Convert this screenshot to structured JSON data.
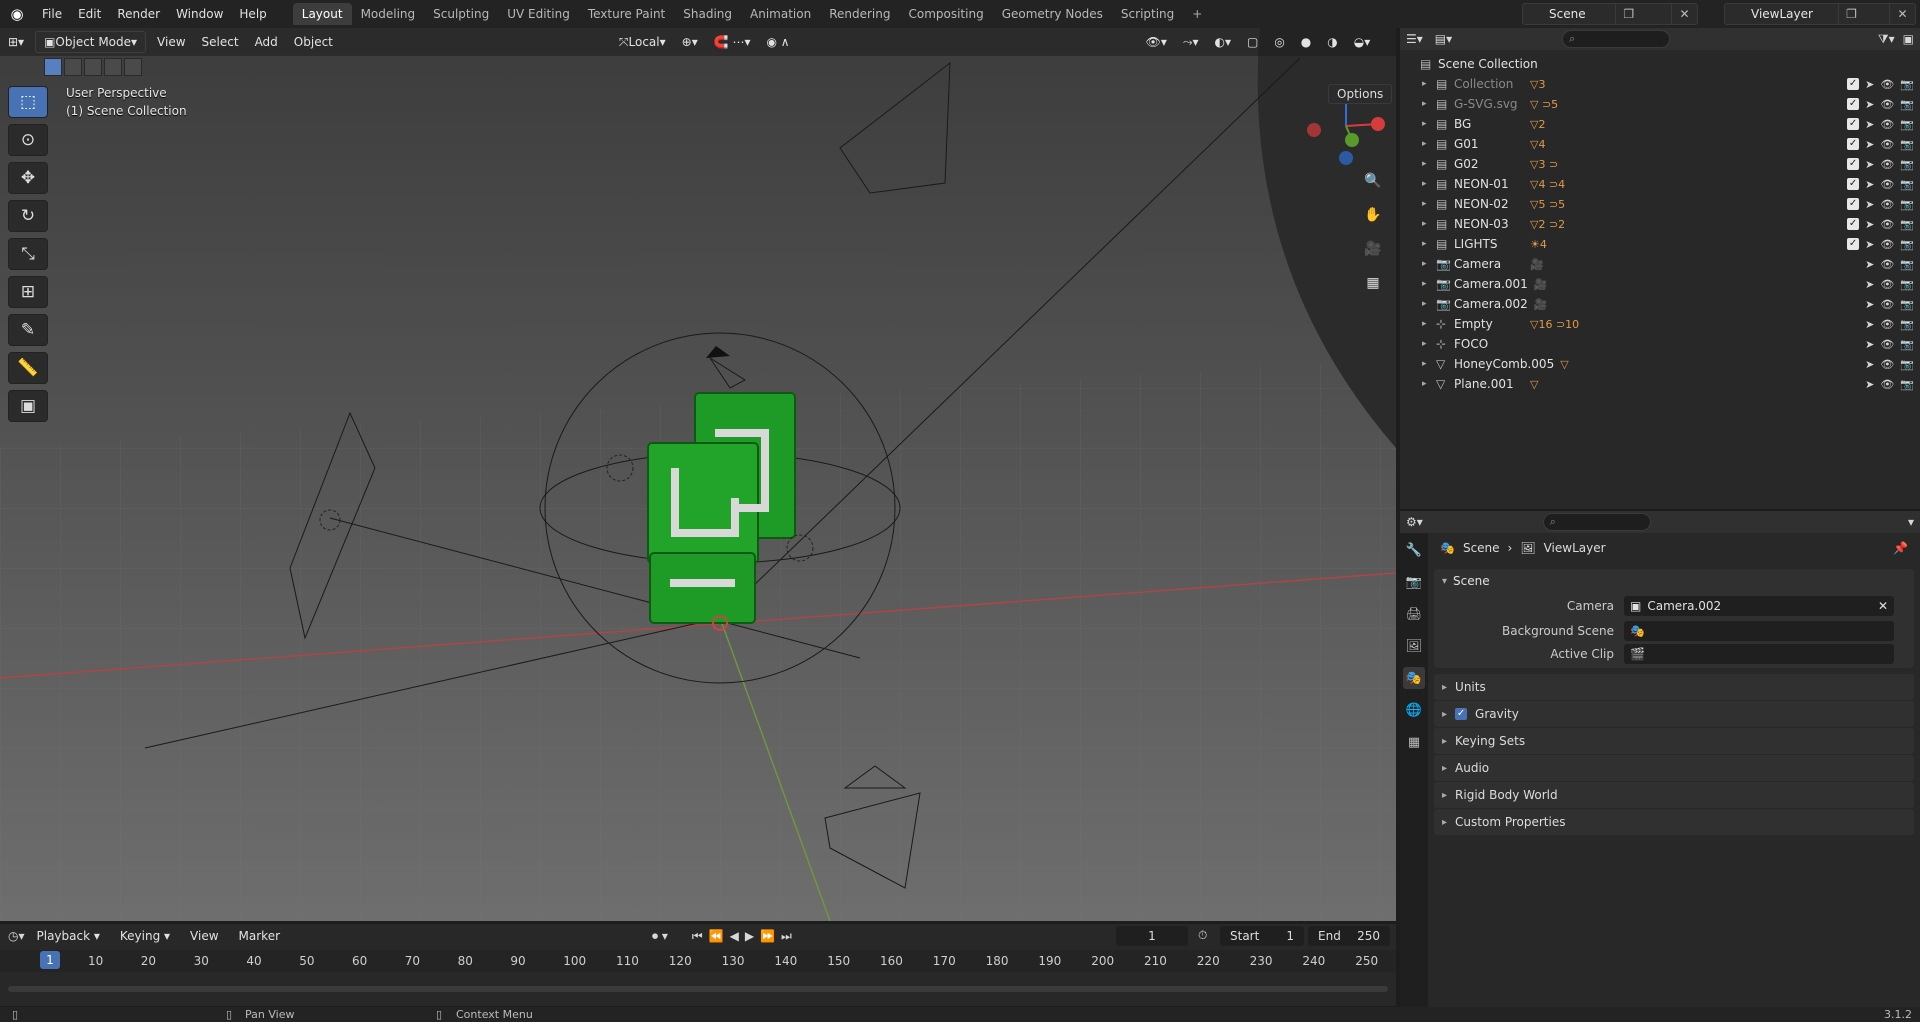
{
  "menu": [
    "File",
    "Edit",
    "Render",
    "Window",
    "Help"
  ],
  "workspaces": [
    "Layout",
    "Modeling",
    "Sculpting",
    "UV Editing",
    "Texture Paint",
    "Shading",
    "Animation",
    "Rendering",
    "Compositing",
    "Geometry Nodes",
    "Scripting"
  ],
  "active_workspace": "Layout",
  "scene_name": "Scene",
  "view_layer": "ViewLayer",
  "viewport": {
    "mode": "Object Mode",
    "menus": [
      "View",
      "Select",
      "Add",
      "Object"
    ],
    "transform_orientation": "Local",
    "perspective_label": "User Perspective",
    "collection_label": "(1) Scene Collection",
    "options_label": "Options"
  },
  "outliner": {
    "root": "Scene Collection",
    "rows": [
      {
        "name": "Collection",
        "icon": "collection-icon",
        "badge": "▽3",
        "dim": true
      },
      {
        "name": "G-SVG.svg",
        "icon": "collection-icon",
        "badge": "▽ ⊃5",
        "dim": true
      },
      {
        "name": "BG",
        "icon": "collection-icon",
        "badge": "▽2",
        "dim": false
      },
      {
        "name": "G01",
        "icon": "collection-icon",
        "badge": "▽4",
        "dim": false
      },
      {
        "name": "G02",
        "icon": "collection-icon",
        "badge": "▽3 ⊃",
        "dim": false
      },
      {
        "name": "NEON-01",
        "icon": "collection-icon",
        "badge": "▽4 ⊃4",
        "dim": false
      },
      {
        "name": "NEON-02",
        "icon": "collection-icon",
        "badge": "▽5 ⊃5",
        "dim": false
      },
      {
        "name": "NEON-03",
        "icon": "collection-icon",
        "badge": "▽2 ⊃2",
        "dim": false
      },
      {
        "name": "LIGHTS",
        "icon": "collection-icon",
        "badge": "☀4",
        "dim": false
      },
      {
        "name": "Camera",
        "icon": "camera-icon",
        "badge": "🎥",
        "dim": false
      },
      {
        "name": "Camera.001",
        "icon": "camera-icon",
        "badge": "🎥",
        "dim": false
      },
      {
        "name": "Camera.002",
        "icon": "camera-icon",
        "badge": "🎥",
        "dim": false
      },
      {
        "name": "Empty",
        "icon": "empty-icon",
        "badge": "▽16 ⊃10",
        "dim": false
      },
      {
        "name": "FOCO",
        "icon": "empty-icon",
        "badge": "",
        "dim": false
      },
      {
        "name": "HoneyComb.005",
        "icon": "mesh-icon",
        "badge": "▽",
        "dim": false
      },
      {
        "name": "Plane.001",
        "icon": "mesh-icon",
        "badge": "▽",
        "dim": false
      }
    ]
  },
  "properties": {
    "breadcrumb_scene": "Scene",
    "breadcrumb_layer": "ViewLayer",
    "panel_title": "Scene",
    "camera_label": "Camera",
    "camera_value": "Camera.002",
    "bg_scene_label": "Background Scene",
    "active_clip_label": "Active Clip",
    "subpanels": [
      "Units",
      "Gravity",
      "Keying Sets",
      "Audio",
      "Rigid Body World",
      "Custom Properties"
    ]
  },
  "timeline": {
    "menus": [
      "Playback",
      "Keying",
      "View",
      "Marker"
    ],
    "current_frame": "1",
    "start_label": "Start",
    "start": "1",
    "end_label": "End",
    "end": "250",
    "ticks": [
      "10",
      "20",
      "30",
      "40",
      "50",
      "60",
      "70",
      "80",
      "90",
      "100",
      "110",
      "120",
      "130",
      "140",
      "150",
      "160",
      "170",
      "180",
      "190",
      "200",
      "210",
      "220",
      "230",
      "240",
      "250"
    ]
  },
  "status": {
    "pan": "Pan View",
    "context": "Context Menu",
    "version": "3.1.2"
  }
}
